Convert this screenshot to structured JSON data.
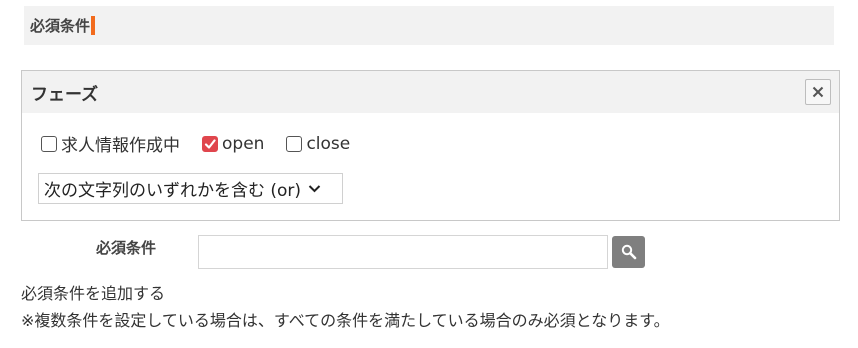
{
  "section": {
    "title": "必須条件"
  },
  "phase_panel": {
    "title": "フェーズ",
    "close_icon": "close-icon",
    "options": [
      {
        "label": "求人情報作成中",
        "checked": false
      },
      {
        "label": "open",
        "checked": true
      },
      {
        "label": "close",
        "checked": false
      }
    ],
    "match_mode": {
      "selected": "次の文字列のいずれかを含む (or)"
    }
  },
  "required_field": {
    "label": "必須条件",
    "value": "",
    "search_icon": "search-icon"
  },
  "add_link": "必須条件を追加する",
  "note": "※複数条件を設定している場合は、すべての条件を満たしている場合のみ必須となります。",
  "colors": {
    "accent": "#f26b1d",
    "checked": "#e0464d",
    "search_button": "#7f7f7f"
  }
}
